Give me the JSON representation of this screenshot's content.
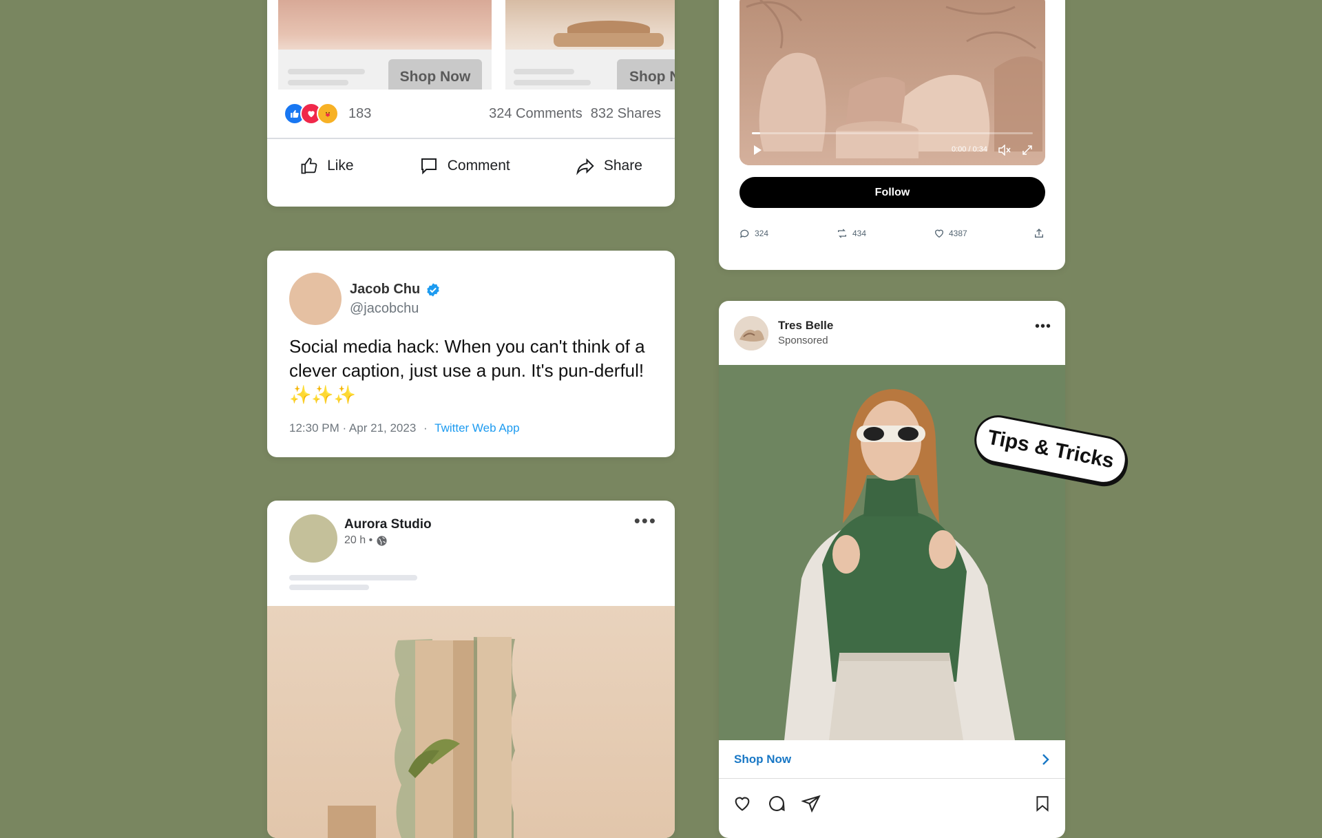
{
  "fb_carousel": {
    "shop_now_1": "Shop Now",
    "shop_now_2": "Shop N",
    "reaction_count": "183",
    "comments": "324 Comments",
    "shares": "832 Shares",
    "like": "Like",
    "comment": "Comment",
    "share": "Share"
  },
  "tweet": {
    "name": "Jacob Chu",
    "handle": "@jacobchu",
    "text": "Social media hack: When you can't think of a clever caption, just use a pun. It's pun-derful! ✨✨✨",
    "timestamp": "12:30 PM · Apr 21, 2023",
    "separator": "·",
    "source": "Twitter Web App"
  },
  "fb_post": {
    "page_name": "Aurora Studio",
    "time": "20 h •"
  },
  "video_card": {
    "time_display": "0:00 / 0:34",
    "follow": "Follow",
    "replies": "324",
    "retweets": "434",
    "likes": "4387",
    "progress": 0.03
  },
  "insta": {
    "account": "Tres Belle",
    "sponsored": "Sponsored",
    "shop_now": "Shop Now"
  },
  "sticker": {
    "text": "Tips & Tricks"
  },
  "colors": {
    "background": "#798660",
    "fb_blue": "#1877f2",
    "twitter_blue": "#1d9bf0",
    "insta_link": "#1877c5"
  }
}
